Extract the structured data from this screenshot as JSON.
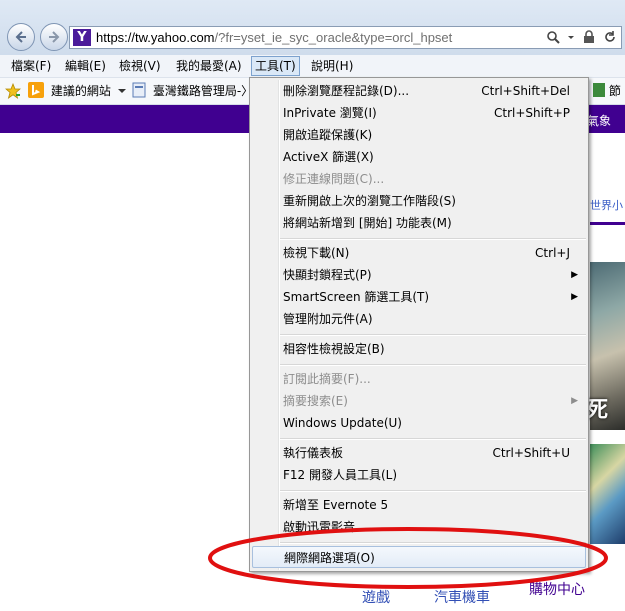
{
  "browser": {
    "url_host": "https://tw.yahoo.com",
    "url_rest": "/?fr=yset_ie_syc_oracle&type=orcl_hpset",
    "favicon_letter": "Y"
  },
  "menubar": {
    "file": "檔案(F)",
    "edit": "編輯(E)",
    "view": "檢視(V)",
    "favorites": "我的最愛(A)",
    "tools": "工具(T)",
    "help": "說明(H)"
  },
  "favbar": {
    "suggested": "建議的網站",
    "railway": "臺灣鐵路管理局-〉",
    "right_glyph": "節"
  },
  "page": {
    "purple_bar_text": "氣象",
    "right_links": "世界小",
    "photo_caption": "死",
    "bottom_links": [
      "遊戲",
      "汽車機車",
      "購物中心"
    ]
  },
  "tools_menu": {
    "items": [
      {
        "label": "刪除瀏覽歷程記錄(D)...",
        "shortcut": "Ctrl+Shift+Del"
      },
      {
        "label": "InPrivate 瀏覽(I)",
        "shortcut": "Ctrl+Shift+P"
      },
      {
        "label": "開啟追蹤保護(K)",
        "shortcut": ""
      },
      {
        "label": "ActiveX 篩選(X)",
        "shortcut": ""
      },
      {
        "label": "修正連線問題(C)...",
        "shortcut": ""
      },
      {
        "label": "重新開啟上次的瀏覽工作階段(S)",
        "shortcut": ""
      },
      {
        "label": "將網站新增到 [開始] 功能表(M)",
        "shortcut": ""
      },
      {
        "label": "檢視下載(N)",
        "shortcut": "Ctrl+J"
      },
      {
        "label": "快顯封鎖程式(P)",
        "shortcut": ""
      },
      {
        "label": "SmartScreen 篩選工具(T)",
        "shortcut": ""
      },
      {
        "label": "管理附加元件(A)",
        "shortcut": ""
      },
      {
        "label": "相容性檢視設定(B)",
        "shortcut": ""
      },
      {
        "label": "訂閱此摘要(F)...",
        "shortcut": ""
      },
      {
        "label": "摘要搜索(E)",
        "shortcut": ""
      },
      {
        "label": "Windows Update(U)",
        "shortcut": ""
      },
      {
        "label": "執行儀表板",
        "shortcut": "Ctrl+Shift+U"
      },
      {
        "label": "F12 開發人員工具(L)",
        "shortcut": ""
      },
      {
        "label": "新增至 Evernote 5",
        "shortcut": ""
      },
      {
        "label": "啟動迅雷影音",
        "shortcut": ""
      },
      {
        "label": "網際網路選項(O)",
        "shortcut": ""
      }
    ]
  }
}
